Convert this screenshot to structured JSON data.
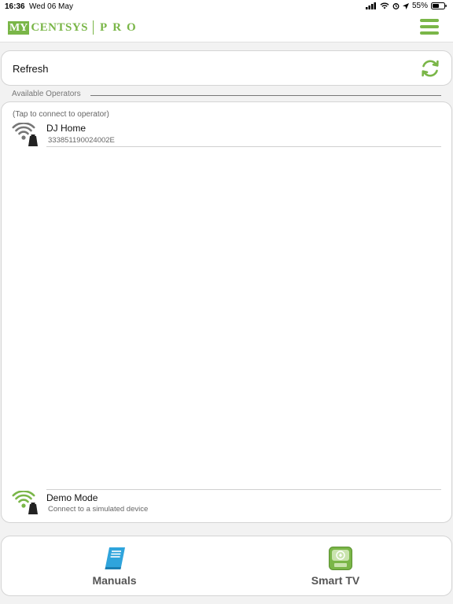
{
  "status_bar": {
    "time": "16:36",
    "date": "Wed 06 May",
    "battery": "55%"
  },
  "header": {
    "logo_my": "MY",
    "logo_brand": "CENTSYS",
    "logo_suffix": "PRO",
    "menu_icon": "hamburger-menu-icon"
  },
  "refresh": {
    "label": "Refresh",
    "icon": "refresh-icon"
  },
  "section": {
    "title": "Available Operators"
  },
  "operators": {
    "hint": "(Tap to connect to operator)",
    "items": [
      {
        "name": "DJ Home",
        "id": "333851190024002E",
        "icon": "wifi-operator-icon"
      }
    ],
    "demo": {
      "name": "Demo Mode",
      "subtitle": "Connect to a simulated device",
      "icon": "wifi-operator-demo-icon"
    }
  },
  "tabs": [
    {
      "label": "Manuals",
      "icon": "manual-book-icon"
    },
    {
      "label": "Smart TV",
      "icon": "smart-tv-icon"
    }
  ],
  "colors": {
    "brand_green": "#7ab648",
    "icon_blue": "#2fa4dc",
    "wifi_gray": "#777777"
  }
}
